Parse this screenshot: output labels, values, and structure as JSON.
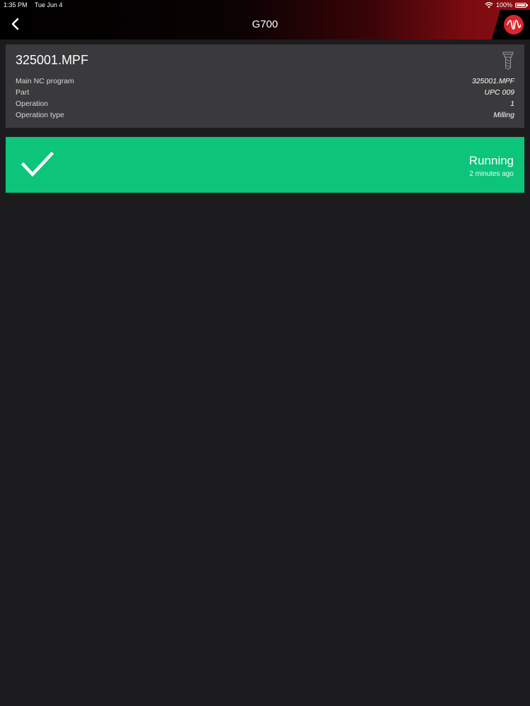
{
  "status_bar": {
    "time": "1:35 PM",
    "date": "Tue Jun 4",
    "battery": "100%"
  },
  "nav": {
    "title": "G700",
    "back_icon": "chevron-left-icon",
    "logo_icon": "waveform-logo-icon"
  },
  "program": {
    "title": "325001.MPF",
    "tool_icon": "milling-tool-icon",
    "rows": [
      {
        "label": "Main NC program",
        "value": "325001.MPF"
      },
      {
        "label": "Part",
        "value": "UPC 009"
      },
      {
        "label": "Operation",
        "value": "1"
      },
      {
        "label": "Operation type",
        "value": "Milling"
      }
    ]
  },
  "machine_status": {
    "label": "Running",
    "time": "2 minutes ago",
    "icon": "checkmark-icon",
    "color": "#0cc47a"
  },
  "colors": {
    "background": "#1c1c1e",
    "card": "#3a3a3c",
    "brand_red": "#d8262e"
  }
}
